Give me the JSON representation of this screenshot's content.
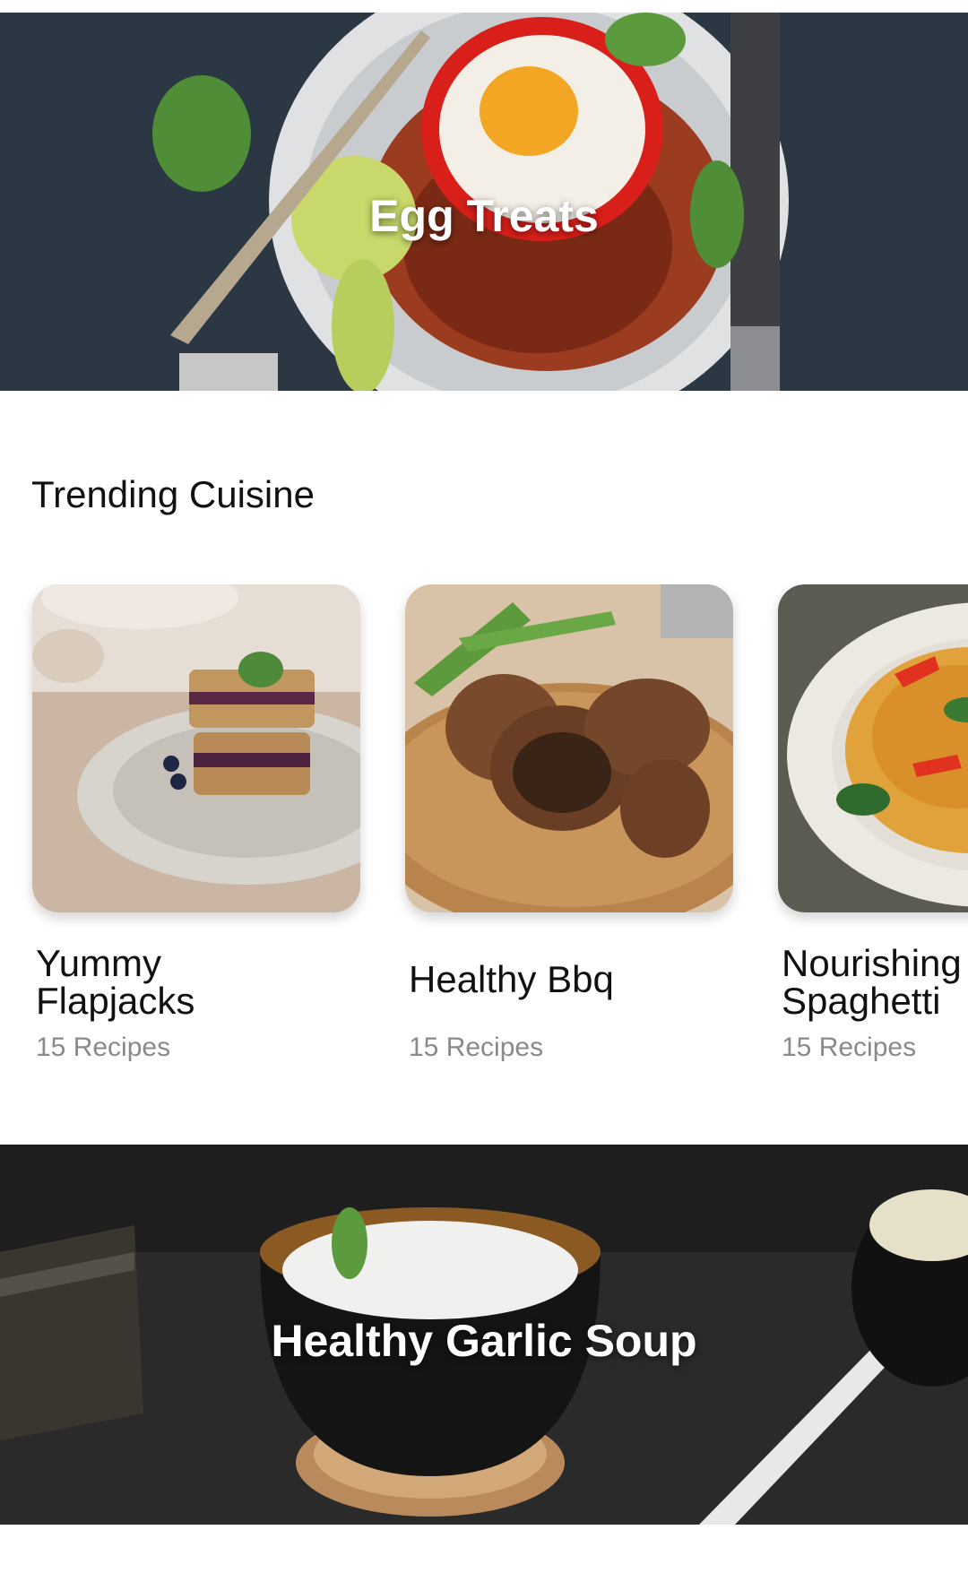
{
  "banners": {
    "top": {
      "title": "Egg Treats"
    },
    "bottom": {
      "title": "Healthy Garlic Soup"
    }
  },
  "trending": {
    "title": "Trending Cuisine",
    "cards": [
      {
        "title": "Yummy\nFlapjacks",
        "subtitle": "15 Recipes",
        "image": "flapjack-photo"
      },
      {
        "title": "Healthy Bbq",
        "subtitle": "15 Recipes",
        "image": "bbq-chicken-photo"
      },
      {
        "title": "Nourishing\nSpaghetti",
        "subtitle": "15 Recipes",
        "image": "spaghetti-photo"
      }
    ]
  },
  "colors": {
    "background": "#ffffff",
    "text_primary": "#111111",
    "text_secondary": "#8a8a8a",
    "banner_title": "#ffffff"
  }
}
